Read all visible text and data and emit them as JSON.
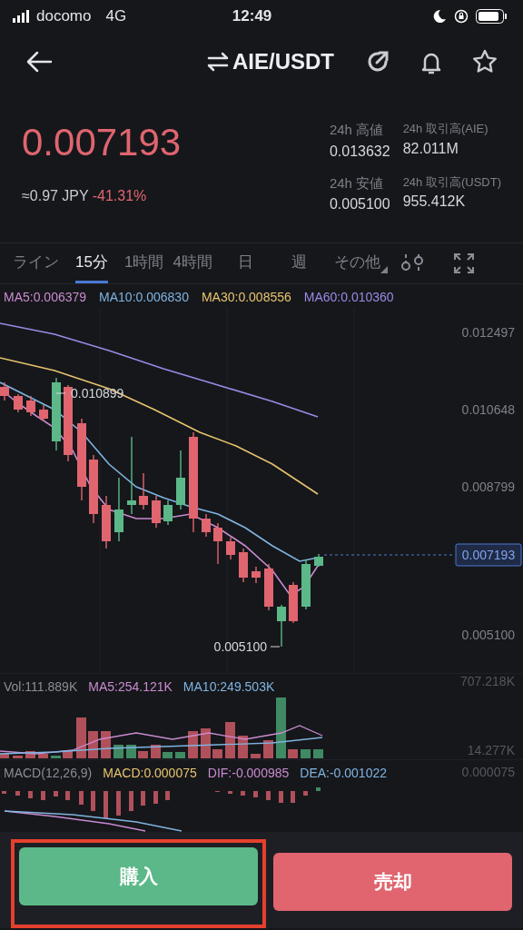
{
  "status_bar": {
    "carrier": "docomo",
    "network": "4G",
    "time": "12:49"
  },
  "header": {
    "title": "AIE/USDT"
  },
  "price": {
    "last": "0.007193",
    "jpy": "≈0.97 JPY",
    "change": "-41.31%"
  },
  "stats": [
    {
      "label": "24h 高値",
      "value": "0.013632"
    },
    {
      "label": "24h 取引高(AIE)",
      "value": "82.011M"
    },
    {
      "label": "24h 安値",
      "value": "0.005100"
    },
    {
      "label": "24h 取引高(USDT)",
      "value": "955.412K"
    }
  ],
  "intervals": [
    {
      "label": "ライン",
      "selected": false
    },
    {
      "label": "15分",
      "selected": true
    },
    {
      "label": "1時間",
      "selected": false
    },
    {
      "label": "4時間",
      "selected": false
    },
    {
      "label": "日",
      "selected": false
    },
    {
      "label": "週",
      "selected": false
    },
    {
      "label": "その他",
      "selected": false
    }
  ],
  "ma_legend": [
    {
      "text": "MA5:0.006379",
      "color": "#c98bd0"
    },
    {
      "text": "MA10:0.006830",
      "color": "#7fb4e0"
    },
    {
      "text": "MA30:0.008556",
      "color": "#e8c46e"
    },
    {
      "text": "MA60:0.010360",
      "color": "#9a8ae6"
    }
  ],
  "price_axis": [
    "0.012497",
    "0.010648",
    "0.008799",
    "0.005100"
  ],
  "current_price_tag": "0.007193",
  "high_label": "0.010899",
  "low_label": "0.005100",
  "volume": {
    "legend": [
      {
        "text": "Vol:111.889K",
        "color": "#8a8d96"
      },
      {
        "text": "MA5:254.121K",
        "color": "#c98bd0"
      },
      {
        "text": "MA10:249.503K",
        "color": "#7fb4e0"
      }
    ],
    "axis": [
      "707.218K",
      "14.277K"
    ]
  },
  "macd": {
    "legend": [
      {
        "text": "MACD(12,26,9)",
        "color": "#8a8d96"
      },
      {
        "text": "MACD:0.000075",
        "color": "#e8c46e"
      },
      {
        "text": "DIF:-0.000985",
        "color": "#c98bd0"
      },
      {
        "text": "DEA:-0.001022",
        "color": "#7fb4e0"
      }
    ],
    "axis": "0.000075"
  },
  "buttons": [
    {
      "label": "購入",
      "kind": "buy",
      "highlighted": true
    },
    {
      "label": "売却",
      "kind": "sell",
      "highlighted": false
    }
  ]
}
